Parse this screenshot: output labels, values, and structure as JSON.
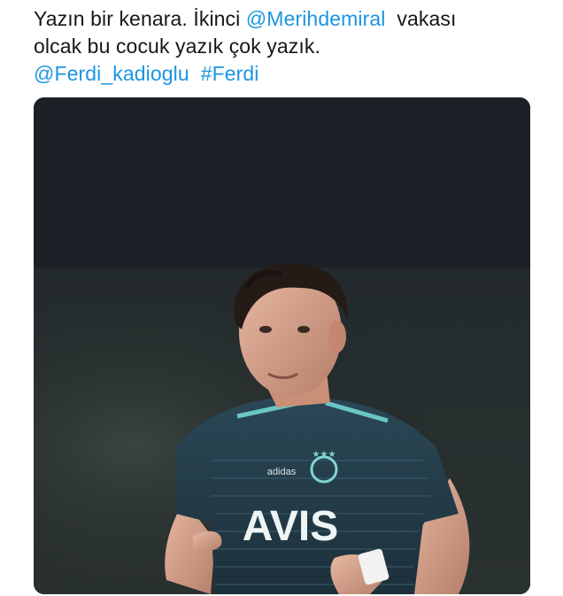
{
  "tweet": {
    "line1_text": "Yazın bir kenara. İkinci ",
    "mention_1": "@Merihdemiral",
    "line1_tail": "  vakası",
    "line2_text": "olcak bu cocuk yazık çok yazık.",
    "mention_2": "@Ferdi_kadioglu",
    "hashtag": "#Ferdi"
  },
  "media": {
    "description_icon": "photo",
    "jersey_sponsor": "AVIS",
    "jersey_brand": "adidas"
  },
  "colors": {
    "link": "#1b95e0",
    "text": "#14171a",
    "image_background": "#1a1f25"
  }
}
